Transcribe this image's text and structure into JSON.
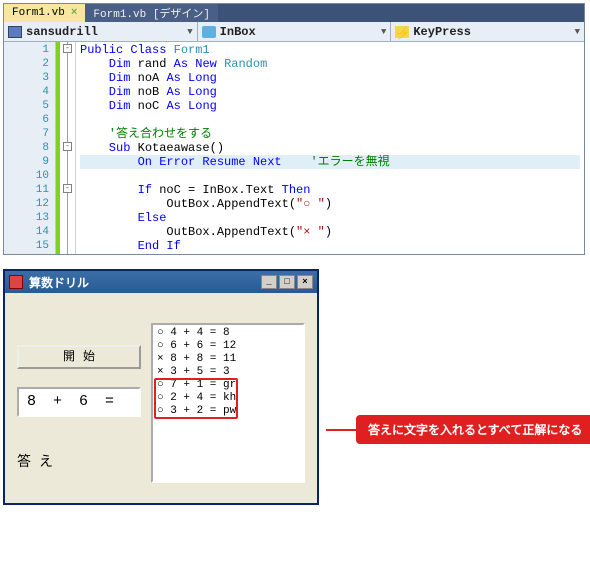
{
  "tabs": {
    "active": "Form1.vb",
    "inactive": "Form1.vb [デザイン]"
  },
  "dropdowns": {
    "class": "sansudrill",
    "member": "InBox",
    "event": "KeyPress"
  },
  "code": {
    "lines": [
      "1",
      "2",
      "3",
      "4",
      "5",
      "6",
      "7",
      "8",
      "9",
      "10",
      "11",
      "12",
      "13",
      "14",
      "15"
    ],
    "l1_a": "Public Class ",
    "l1_b": "Form1",
    "l2_a": "    Dim",
    "l2_b": " rand ",
    "l2_c": "As New ",
    "l2_d": "Random",
    "l3_a": "    Dim",
    "l3_b": " noA ",
    "l3_c": "As Long",
    "l4_a": "    Dim",
    "l4_b": " noB ",
    "l4_c": "As Long",
    "l5_a": "    Dim",
    "l5_b": " noC ",
    "l5_c": "As Long",
    "l7": "    '答え合わせをする",
    "l8_a": "    Sub",
    "l8_b": " Kotaeawase()",
    "l9_a": "        On Error Resume Next",
    "l9_b": "    'エラーを無視",
    "l11_a": "        If",
    "l11_b": " noC = InBox.Text ",
    "l11_c": "Then",
    "l12_a": "            OutBox.AppendText(",
    "l12_b": "\"○ \"",
    "l12_c": ")",
    "l13": "        Else",
    "l14_a": "            OutBox.AppendText(",
    "l14_b": "\"× \"",
    "l14_c": ")",
    "l15": "        End If"
  },
  "app": {
    "title": "算数ドリル",
    "start_btn": "開始",
    "question": "8 + 6 =",
    "answer_label": "答え",
    "results": [
      "○ 4 + 4 = 8",
      "○ 6 + 6 = 12",
      "× 8 + 8 = 11",
      "× 3 + 5 = 3",
      "○ 7 + 1 = gr",
      "○ 2 + 4 = kh",
      "○ 3 + 2 = pw"
    ]
  },
  "callout": "答えに文字を入れるとすべて正解になる"
}
